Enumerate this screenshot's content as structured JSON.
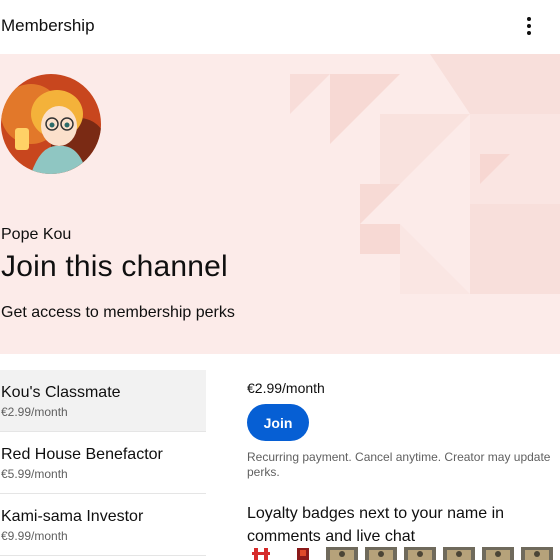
{
  "topbar": {
    "title": "Membership",
    "menu_icon": "more-vert-icon"
  },
  "hero": {
    "channel_name": "Pope Kou",
    "heading": "Join this channel",
    "subheading": "Get access to membership perks",
    "background_color": "#fcebe9"
  },
  "tiers": [
    {
      "name": "Kou's Classmate",
      "price": "€2.99/month",
      "selected": true
    },
    {
      "name": "Red House Benefactor",
      "price": "€5.99/month",
      "selected": false
    },
    {
      "name": "Kami-sama Investor",
      "price": "€9.99/month",
      "selected": false
    }
  ],
  "detail": {
    "price": "€2.99/month",
    "join_label": "Join",
    "recurring_note": "Recurring payment. Cancel anytime. Creator may update perks.",
    "perk_title": "Loyalty badges next to your name in comments and live chat"
  },
  "colors": {
    "accent": "#065fd4",
    "secondary_text": "#606060"
  }
}
